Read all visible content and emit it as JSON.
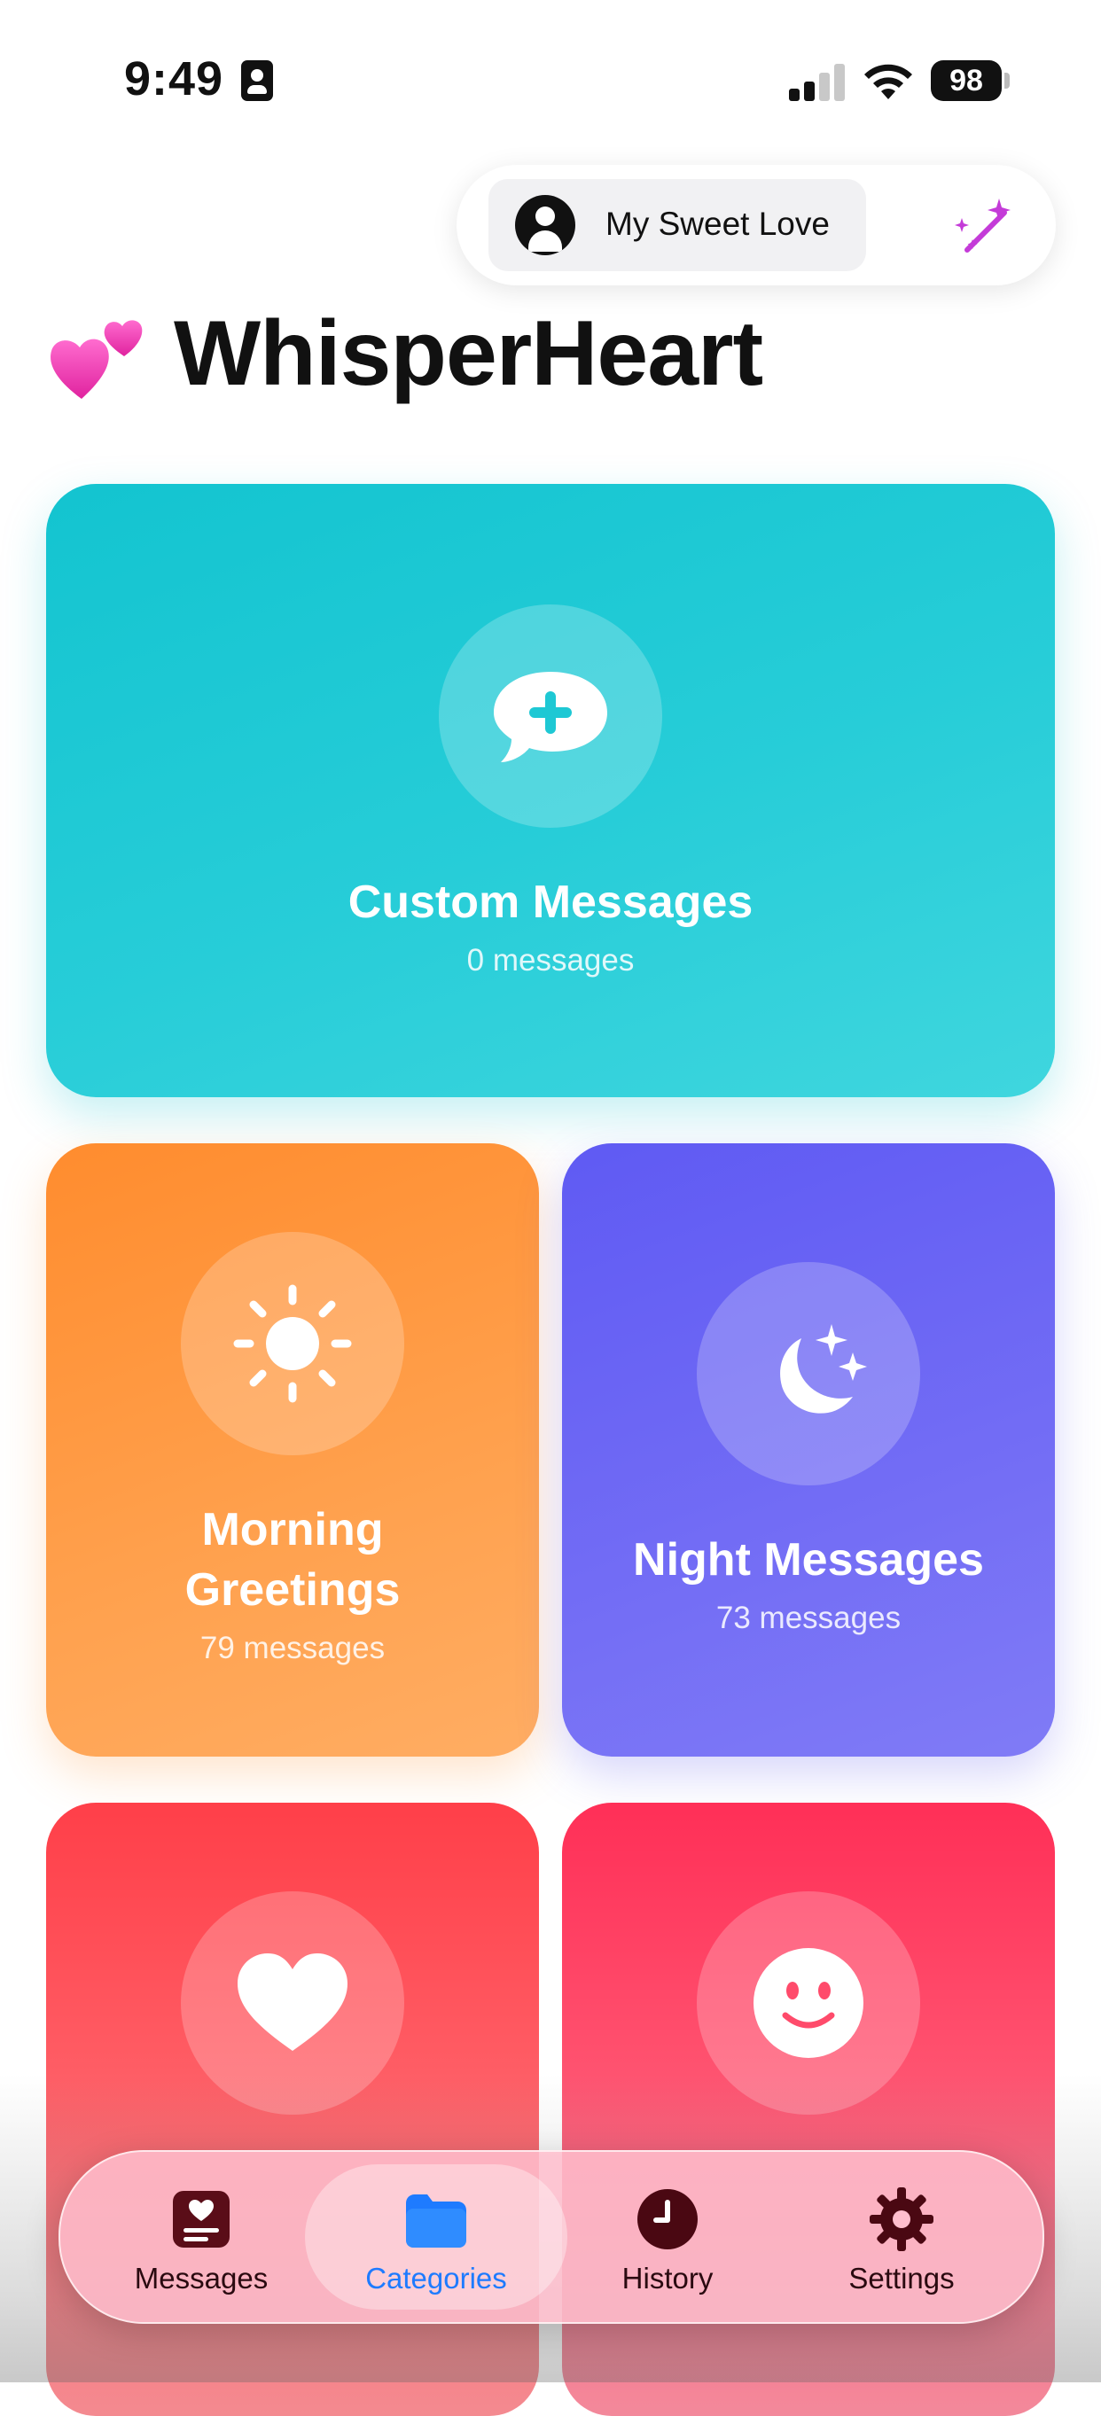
{
  "status_bar": {
    "time": "9:49",
    "battery": "98"
  },
  "profile": {
    "partner_name": "My Sweet Love"
  },
  "app": {
    "title": "WhisperHeart"
  },
  "categories": [
    {
      "id": "custom",
      "title": "Custom Messages",
      "count": "0 messages",
      "icon": "message-plus-icon",
      "color": "#1ec8d4"
    },
    {
      "id": "morning",
      "title_line1": "Morning",
      "title_line2": "Greetings",
      "count": "79 messages",
      "icon": "sun-icon",
      "color": "#ff962f"
    },
    {
      "id": "night",
      "title": "Night Messages",
      "count": "73 messages",
      "icon": "moon-stars-icon",
      "color": "#6a65f4"
    },
    {
      "id": "love",
      "icon": "heart-icon",
      "color": "#ff4a52"
    },
    {
      "id": "sweet",
      "icon": "smiley-icon",
      "color": "#ff3b5f"
    }
  ],
  "tab_bar": {
    "selected": "Categories",
    "accent": "#1e7bff",
    "tabs": [
      {
        "label": "Messages",
        "icon": "message-card-icon"
      },
      {
        "label": "Categories",
        "icon": "folder-icon"
      },
      {
        "label": "History",
        "icon": "clock-icon"
      },
      {
        "label": "Settings",
        "icon": "gear-icon"
      }
    ]
  }
}
